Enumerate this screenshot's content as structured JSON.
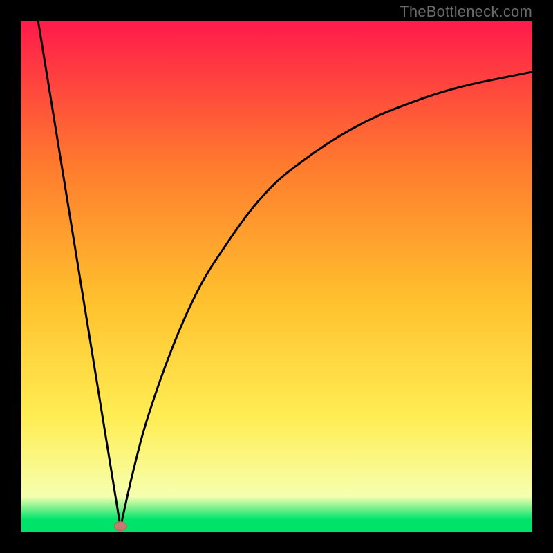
{
  "attribution": "TheBottleneck.com",
  "colors": {
    "frame": "#000000",
    "gradient_top": "#ff1a4b",
    "gradient_mid_upper": "#ff7a2e",
    "gradient_mid": "#ffc22e",
    "gradient_mid_lower": "#ffee55",
    "gradient_pale": "#f6ffb0",
    "gradient_green": "#00e36b",
    "curve": "#000000",
    "marker_fill": "#c77b70",
    "marker_stroke": "#b46258"
  },
  "chart_data": {
    "type": "line",
    "title": "",
    "xlabel": "",
    "ylabel": "",
    "x_range": [
      0,
      100
    ],
    "y_range": [
      0,
      100
    ],
    "minimum_x": 19.5,
    "marker": {
      "x": 19.5,
      "y": 1.2
    },
    "left_branch": [
      {
        "x": 3.4,
        "y": 100
      },
      {
        "x": 19.5,
        "y": 1.0
      }
    ],
    "right_branch": [
      {
        "x": 19.5,
        "y": 1.0
      },
      {
        "x": 22,
        "y": 12
      },
      {
        "x": 25,
        "y": 23
      },
      {
        "x": 30,
        "y": 37
      },
      {
        "x": 35,
        "y": 48
      },
      {
        "x": 40,
        "y": 56
      },
      {
        "x": 45,
        "y": 63
      },
      {
        "x": 50,
        "y": 68.5
      },
      {
        "x": 55,
        "y": 72.5
      },
      {
        "x": 60,
        "y": 76
      },
      {
        "x": 65,
        "y": 79
      },
      {
        "x": 70,
        "y": 81.5
      },
      {
        "x": 75,
        "y": 83.5
      },
      {
        "x": 80,
        "y": 85.3
      },
      {
        "x": 85,
        "y": 86.8
      },
      {
        "x": 90,
        "y": 88
      },
      {
        "x": 95,
        "y": 89
      },
      {
        "x": 100,
        "y": 90
      }
    ],
    "gradient_stops": [
      {
        "offset": 0.0,
        "key": "gradient_top"
      },
      {
        "offset": 0.28,
        "key": "gradient_mid_upper"
      },
      {
        "offset": 0.55,
        "key": "gradient_mid"
      },
      {
        "offset": 0.78,
        "key": "gradient_mid_lower"
      },
      {
        "offset": 0.93,
        "key": "gradient_pale"
      },
      {
        "offset": 0.975,
        "key": "gradient_green"
      },
      {
        "offset": 1.0,
        "key": "gradient_green"
      }
    ]
  }
}
